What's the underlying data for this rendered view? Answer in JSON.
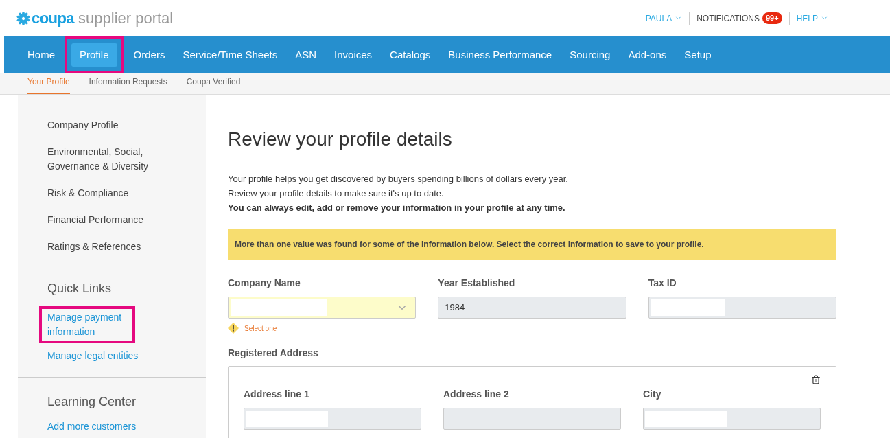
{
  "logo": {
    "brand": "coupa",
    "product": "supplier portal"
  },
  "top_links": [
    {
      "kind": "menu",
      "label": "PAULA"
    },
    {
      "kind": "badge",
      "label": "NOTIFICATIONS",
      "badge": "99+"
    },
    {
      "kind": "menu",
      "label": "HELP"
    }
  ],
  "nav": [
    {
      "label": "Home",
      "selected": false,
      "highlighted": false
    },
    {
      "label": "Profile",
      "selected": true,
      "highlighted": true
    },
    {
      "label": "Orders",
      "selected": false,
      "highlighted": false
    },
    {
      "label": "Service/Time Sheets",
      "selected": false,
      "highlighted": false
    },
    {
      "label": "ASN",
      "selected": false,
      "highlighted": false
    },
    {
      "label": "Invoices",
      "selected": false,
      "highlighted": false
    },
    {
      "label": "Catalogs",
      "selected": false,
      "highlighted": false
    },
    {
      "label": "Business Performance",
      "selected": false,
      "highlighted": false
    },
    {
      "label": "Sourcing",
      "selected": false,
      "highlighted": false
    },
    {
      "label": "Add-ons",
      "selected": false,
      "highlighted": false
    },
    {
      "label": "Setup",
      "selected": false,
      "highlighted": false
    }
  ],
  "subnav": [
    {
      "label": "Your Profile",
      "selected": true
    },
    {
      "label": "Information Requests",
      "selected": false
    },
    {
      "label": "Coupa Verified",
      "selected": false
    }
  ],
  "sidebar": {
    "items": [
      "Company Profile",
      "Environmental, Social, Governance & Diversity",
      "Risk & Compliance",
      "Financial Performance",
      "Ratings & References"
    ],
    "sections": [
      {
        "title": "Quick Links",
        "links": [
          {
            "label": "Manage payment information",
            "highlighted": true
          },
          {
            "label": "Manage legal entities",
            "highlighted": false
          }
        ]
      },
      {
        "title": "Learning Center",
        "links": [
          {
            "label": "Add more customers",
            "highlighted": false
          }
        ]
      }
    ]
  },
  "main": {
    "title": "Review your profile details",
    "intro": [
      "Your profile helps you get discovered by buyers spending billions of dollars every year.",
      "Review your profile details to make sure it's up to date."
    ],
    "intro_bold": "You can always edit, add or remove your information in your profile at any time.",
    "alert": "More than one value was found for some of the information below. Select the correct information to save to your profile.",
    "fields": [
      {
        "kind": "select",
        "label": "Company Name",
        "redacted": true,
        "warning": "Select one"
      },
      {
        "kind": "text",
        "label": "Year Established",
        "value": "1984",
        "redacted": false
      },
      {
        "kind": "text",
        "label": "Tax ID",
        "redacted": true
      }
    ],
    "address": {
      "title": "Registered Address",
      "fields": [
        {
          "label": "Address line 1",
          "redacted": true
        },
        {
          "label": "Address line 2",
          "redacted": false
        },
        {
          "label": "City",
          "redacted": true
        }
      ]
    }
  }
}
